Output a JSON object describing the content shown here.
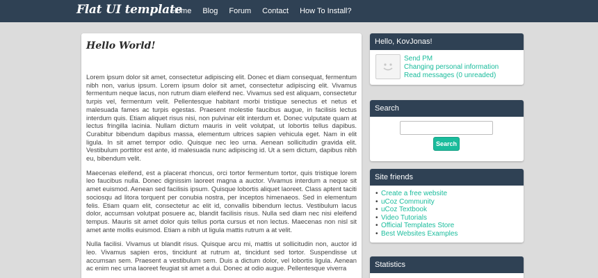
{
  "header": {
    "logo": "Flat UI template",
    "nav": [
      "Home",
      "Blog",
      "Forum",
      "Contact",
      "How To Install?"
    ]
  },
  "post": {
    "title": "Hello World!",
    "paragraphs": [
      "Lorem ipsum dolor sit amet, consectetur adipiscing elit. Donec et diam consequat, fermentum nibh non, varius ipsum. Lorem ipsum dolor sit amet, consectetur adipiscing elit. Vivamus fermentum neque lacus, non rutrum diam eleifend nec. Vivamus sed est aliquam, consectetur turpis vel, fermentum velit. Pellentesque habitant morbi tristique senectus et netus et malesuada fames ac turpis egestas. Praesent molestie faucibus augue, in facilisis lectus interdum quis. Etiam aliquet risus nisi, non pulvinar elit interdum et. Donec vulputate quam at lectus fringilla lacinia. Nullam dictum mauris in velit volutpat, ut lobortis tellus dapibus. Curabitur bibendum dapibus massa, elementum ultrices sapien vehicula eget. Nam in elit ligula. In sit amet tempor odio. Quisque nec leo urna. Aenean sollicitudin gravida elit. Vestibulum porttitor est ante, id malesuada nunc adipiscing id. Ut a sem dictum, dapibus nibh eu, bibendum velit.",
      "Maecenas eleifend, est a placerat rhoncus, orci tortor fermentum tortor, quis tristique lorem leo faucibus nulla. Donec dignissim laoreet magna a auctor. Vivamus interdum a neque sit amet euismod. Aenean sed facilisis ipsum. Quisque lobortis aliquet laoreet. Class aptent taciti sociosqu ad litora torquent per conubia nostra, per inceptos himenaeos. Sed in elementum felis. Etiam quam elit, consectetur ac elit id, convallis bibendum lectus. Vestibulum lacus dolor, accumsan volutpat posuere ac, blandit facilisis risus. Nulla sed diam nec nisi eleifend tempus. Mauris sit amet dolor quis tellus porta cursus et non lectus. Maecenas non nisl sit amet ante mollis euismod. Etiam a nibh ut ligula mattis rutrum a at velit.",
      "Nulla facilisi. Vivamus ut blandit risus. Quisque arcu mi, mattis ut sollicitudin non, auctor id leo. Vivamus sapien eros, tincidunt at rutrum at, tincidunt sed tortor. Suspendisse ut accumsan sem. Praesent a vestibulum sem. Duis a dictum dolor, vel lobortis ligula. Aenean ac enim nec urna laoreet feugiat sit amet a dui. Donec at odio augue. Pellentesque viverra"
    ]
  },
  "sidebar": {
    "user": {
      "greeting": "Hello, KovJonas!",
      "links": [
        "Send PM",
        "Changing personal information",
        "Read messages (0 unreaded)"
      ]
    },
    "search": {
      "title": "Search",
      "button": "Search",
      "value": ""
    },
    "friends": {
      "title": "Site friends",
      "items": [
        "Create a free website",
        "uCoz Community",
        "uCoz Textbook",
        "Video Tutorials",
        "Official Templates Store",
        "Best Websites Examples"
      ]
    },
    "stats": {
      "title": "Statistics"
    }
  },
  "colors": {
    "header_bg": "#2f4154",
    "accent": "#1abc9c",
    "page_bg": "#dcdcdc"
  }
}
